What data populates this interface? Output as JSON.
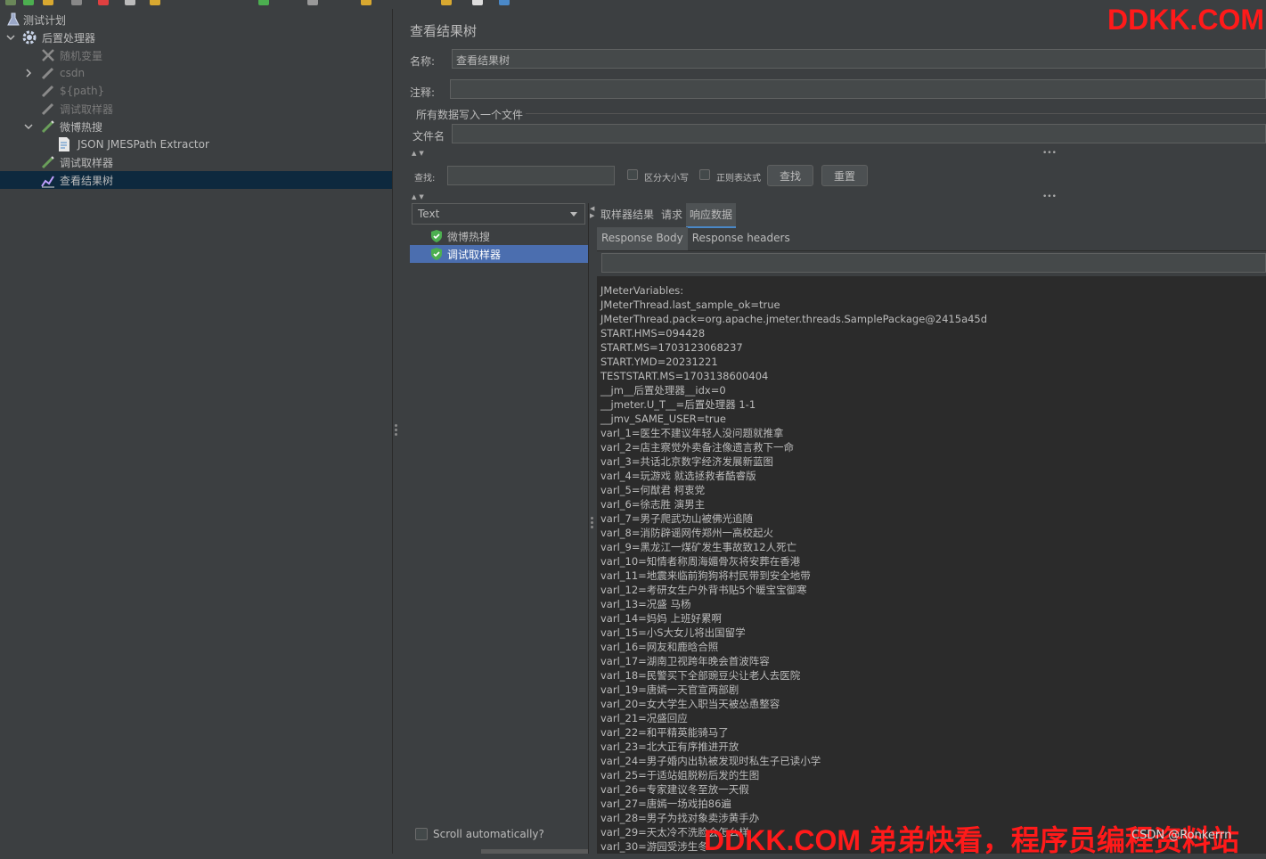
{
  "tree": {
    "items": [
      {
        "label": "测试计划"
      },
      {
        "label": "后置处理器"
      },
      {
        "label": "随机变量"
      },
      {
        "label": "csdn"
      },
      {
        "label": "${path}"
      },
      {
        "label": "调试取样器"
      },
      {
        "label": "微博热搜"
      },
      {
        "label": "JSON JMESPath Extractor"
      },
      {
        "label": "调试取样器"
      },
      {
        "label": "查看结果树"
      }
    ]
  },
  "panel": {
    "title": "查看结果树",
    "name_label": "名称:",
    "name_value": "查看结果树",
    "comment_label": "注释:",
    "comment_value": "",
    "group_title": "所有数据写入一个文件",
    "filename_label": "文件名",
    "filename_value": ""
  },
  "search": {
    "label": "查找:",
    "value": "",
    "case_label": "区分大小写",
    "regex_label": "正则表达式",
    "find_button": "查找",
    "reset_button": "重置"
  },
  "results": {
    "renderer": "Text",
    "samples": [
      "微博热搜",
      "调试取样器"
    ],
    "scroll_auto": "Scroll automatically?"
  },
  "tabs": [
    "取样器结果",
    "请求",
    "响应数据"
  ],
  "subtabs": [
    "Response Body",
    "Response headers"
  ],
  "response_lines": [
    "JMeterVariables:",
    "JMeterThread.last_sample_ok=true",
    "JMeterThread.pack=org.apache.jmeter.threads.SamplePackage@2415a45d",
    "START.HMS=094428",
    "START.MS=1703123068237",
    "START.YMD=20231221",
    "TESTSTART.MS=1703138600404",
    "__jm__后置处理器__idx=0",
    "__jmeter.U_T__=后置处理器 1-1",
    "__jmv_SAME_USER=true",
    "varl_1=医生不建议年轻人没问题就推拿",
    "varl_2=店主察觉外卖备注像遗言救下一命",
    "varl_3=共话北京数字经济发展新蓝图",
    "varl_4=玩游戏 就选拯救者酷睿版",
    "varl_5=何猷君 柯衷党",
    "varl_6=徐志胜 演男主",
    "varl_7=男子爬武功山被佛光追随",
    "varl_8=消防辟谣网传郑州一高校起火",
    "varl_9=黑龙江一煤矿发生事故致12人死亡",
    "varl_10=知情者称周海媚骨灰将安葬在香港",
    "varl_11=地震来临前狗狗将村民带到安全地带",
    "varl_12=考研女生户外背书贴5个暖宝宝御寒",
    "varl_13=况盛 马杨",
    "varl_14=妈妈 上班好累啊",
    "varl_15=小S大女儿将出国留学",
    "varl_16=网友和鹿晗合照",
    "varl_17=湖南卫视跨年晚会首波阵容",
    "varl_18=民警买下全部豌豆尖让老人去医院",
    "varl_19=唐嫣一天官宣两部剧",
    "varl_20=女大学生入职当天被怂恿整容",
    "varl_21=况盛回应",
    "varl_22=和平精英能骑马了",
    "varl_23=北大正有序推进开放",
    "varl_24=男子婚内出轨被发现时私生子已读小学",
    "varl_25=于适站姐脱粉后发的生图",
    "varl_26=专家建议冬至放一天假",
    "varl_27=唐嫣一场戏拍86遍",
    "varl_28=男子为找对象卖涉黄手办",
    "varl_29=天太冷不洗脸会怎么样",
    "varl_30=游园受涉生冬"
  ],
  "watermark": {
    "top": "DDKK.COM",
    "bottom": "DDKK.COM 弟弟快看，程序员编程资料站",
    "csdn": "CSDN @Ronkerrn"
  },
  "colors": {
    "background": "#3c3f41",
    "selection": "#0d293e",
    "result_selection": "#4b6eaf",
    "watermark": "#ff1a1a",
    "ok_green": "#4caf50"
  }
}
